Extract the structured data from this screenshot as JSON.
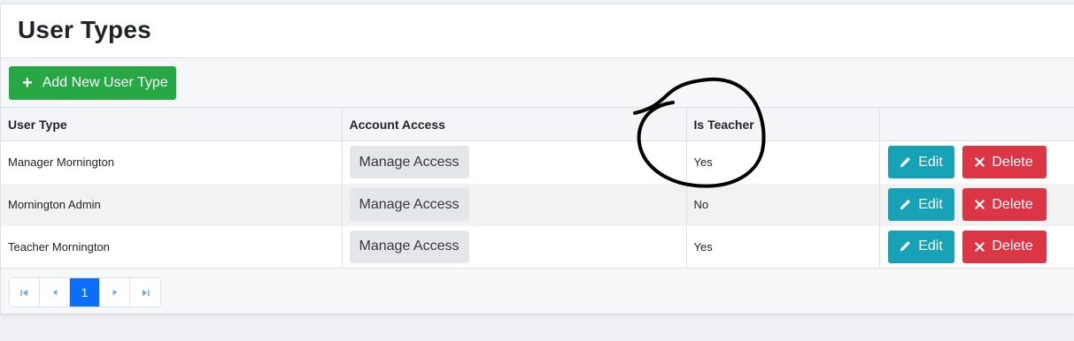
{
  "page": {
    "title": "User Types"
  },
  "toolbar": {
    "add_label": "Add New User Type",
    "add_icon": "plus-icon"
  },
  "table": {
    "headers": [
      "User Type",
      "Account Access",
      "Is Teacher",
      ""
    ],
    "rows": [
      {
        "user_type": "Manager Mornington",
        "access_label": "Manage Access",
        "is_teacher": "Yes"
      },
      {
        "user_type": "Mornington Admin",
        "access_label": "Manage Access",
        "is_teacher": "No"
      },
      {
        "user_type": "Teacher Mornington",
        "access_label": "Manage Access",
        "is_teacher": "Yes"
      }
    ],
    "edit_label": "Edit",
    "delete_label": "Delete"
  },
  "pagination": {
    "first": "⏮",
    "prev": "◀",
    "current": "1",
    "next": "▶",
    "last": "⏭"
  },
  "colors": {
    "add": "#28a745",
    "edit": "#17a2b8",
    "delete": "#dc3545",
    "active_page": "#0d6efd"
  }
}
